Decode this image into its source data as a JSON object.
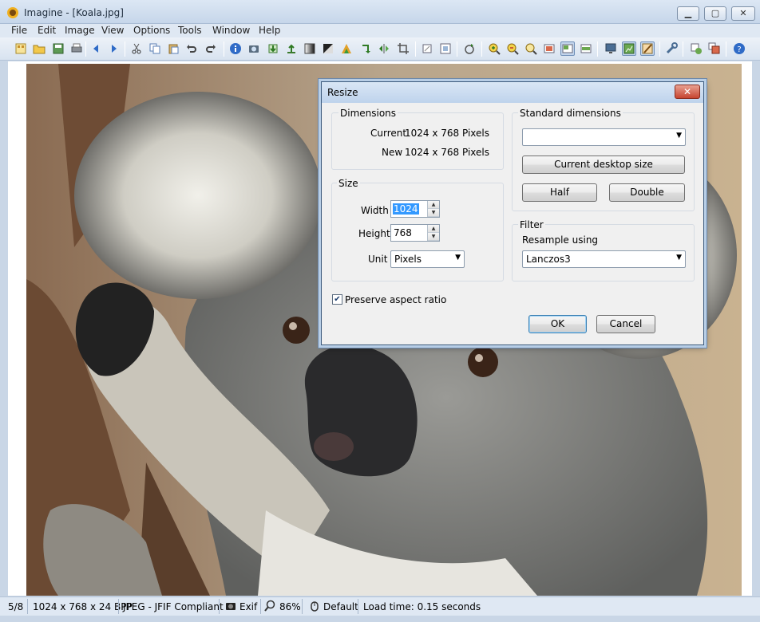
{
  "window": {
    "title": "Imagine - [Koala.jpg]",
    "minimize_glyph": "▁",
    "maximize_glyph": "▢",
    "close_glyph": "✕"
  },
  "menu": [
    "File",
    "Edit",
    "Image",
    "View",
    "Options",
    "Tools",
    "Window",
    "Help"
  ],
  "toolbar": {
    "icons": [
      "thumbnail-icon",
      "open-folder-icon",
      "save-icon",
      "print-icon",
      "previous-icon",
      "next-icon",
      "cut-icon",
      "copy-icon",
      "paste-icon",
      "undo-icon",
      "redo-icon",
      "info-icon",
      "capture-icon",
      "import-icon",
      "export-icon",
      "gradient-icon",
      "contrast-icon",
      "color-icon",
      "rotate-icon",
      "flip-icon",
      "crop-icon",
      "zoom-in-icon",
      "zoom-out-icon",
      "zoom-tool-icon",
      "fit-window-icon",
      "full-size-icon",
      "fit-width-icon",
      "monitor-icon",
      "slideshow-icon",
      "paint-icon",
      "settings-icon",
      "plugin-icon",
      "batch-icon",
      "help-icon"
    ]
  },
  "status": {
    "index": "5/8",
    "dimensions": "1024 x 768 x 24 BPP",
    "format": "JPEG - JFIF Compliant",
    "exif": "Exif",
    "zoom": "86%",
    "profile": "Default",
    "load_time": "Load time: 0.15 seconds"
  },
  "dialog": {
    "title": "Resize",
    "close_glyph": "✕",
    "dimensions": {
      "group_label": "Dimensions",
      "current_label": "Current",
      "current_value": "1024 x 768 Pixels",
      "new_label": "New",
      "new_value": "1024 x 768 Pixels"
    },
    "size": {
      "group_label": "Size",
      "width_label": "Width",
      "width_value": "1024",
      "height_label": "Height",
      "height_value": "768",
      "unit_label": "Unit",
      "unit_value": "Pixels"
    },
    "standard": {
      "group_label": "Standard dimensions",
      "select_value": "",
      "desktop_button": "Current desktop size",
      "half_button": "Half",
      "double_button": "Double"
    },
    "filter": {
      "group_label": "Filter",
      "resample_label": "Resample using",
      "resample_value": "Lanczos3"
    },
    "preserve_aspect_label": "Preserve aspect ratio",
    "preserve_aspect_checked": true,
    "ok_button": "OK",
    "cancel_button": "Cancel"
  }
}
